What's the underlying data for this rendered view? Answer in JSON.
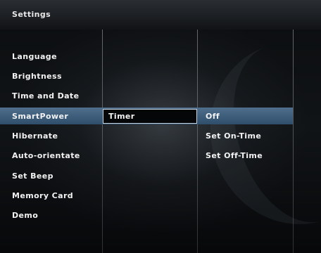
{
  "header": {
    "title": "Settings"
  },
  "menu": {
    "items": [
      {
        "label": "Language"
      },
      {
        "label": "Brightness"
      },
      {
        "label": "Time and Date"
      },
      {
        "label": "SmartPower"
      },
      {
        "label": "Hibernate"
      },
      {
        "label": "Auto-orientate"
      },
      {
        "label": "Set Beep"
      },
      {
        "label": "Memory Card"
      },
      {
        "label": "Demo"
      }
    ],
    "selected": "SmartPower"
  },
  "submenu": {
    "selected": "Timer"
  },
  "options": [
    {
      "label": "Off"
    },
    {
      "label": "Set On-Time"
    },
    {
      "label": "Set Off-Time"
    }
  ],
  "colors": {
    "highlight": "#3f5f7d",
    "background": "#0b0d0f"
  }
}
